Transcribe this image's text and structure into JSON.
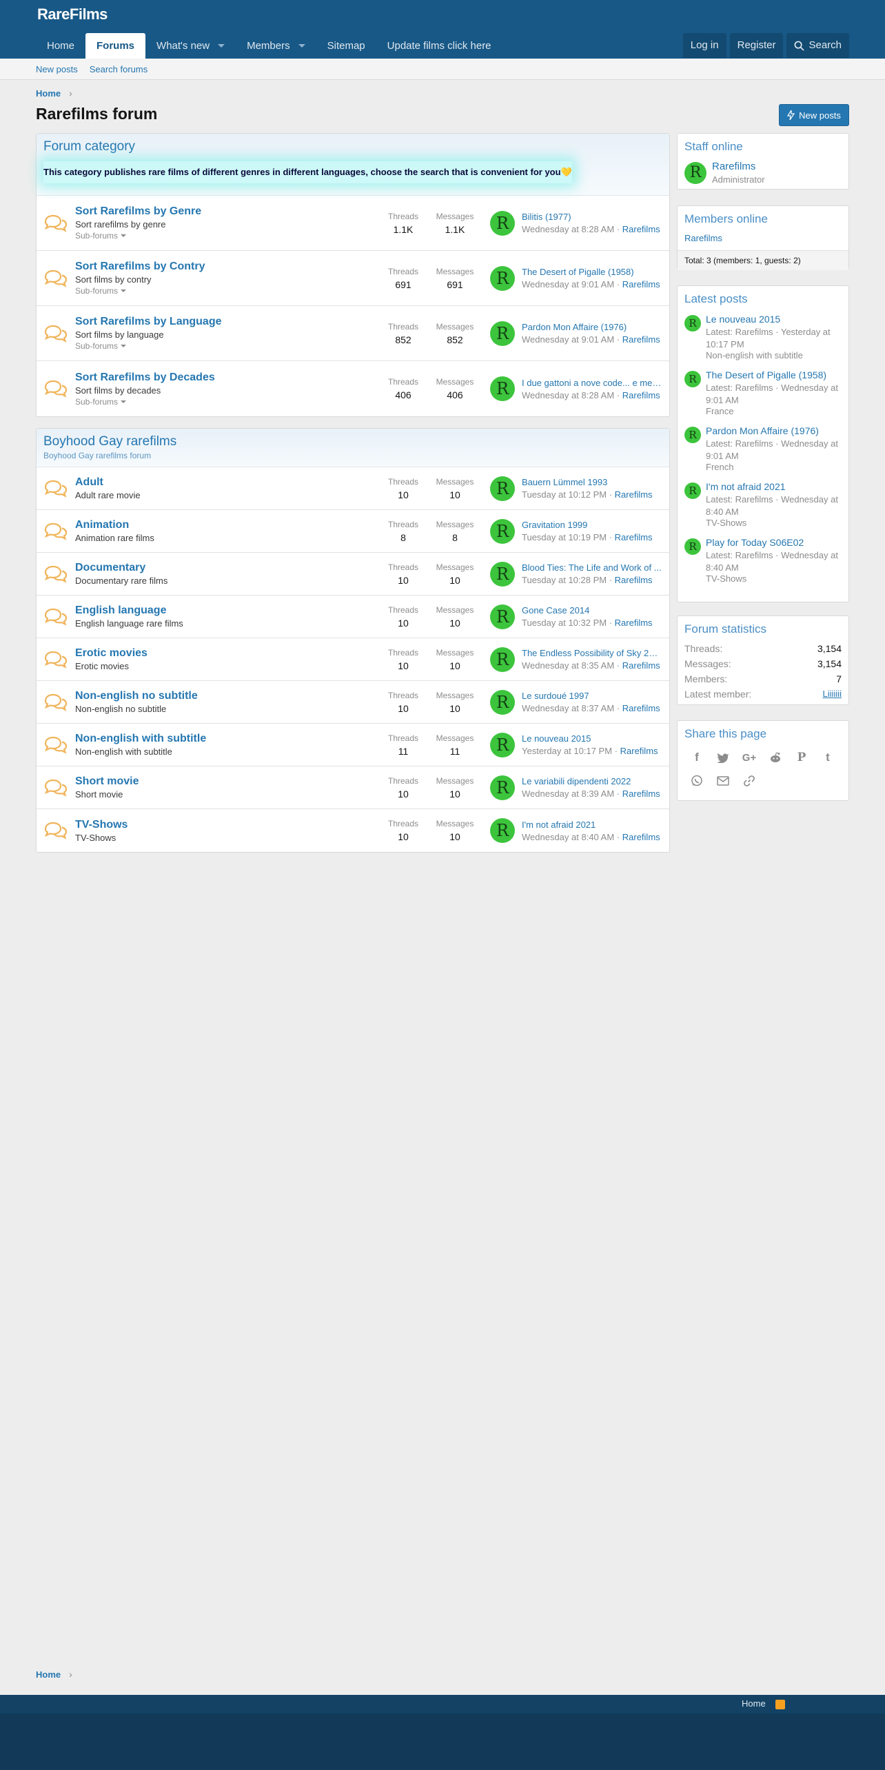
{
  "site": {
    "logo": "RareFilms"
  },
  "nav": {
    "tabs": [
      {
        "label": "Home"
      },
      {
        "label": "Forums"
      },
      {
        "label": "What's new"
      },
      {
        "label": "Members"
      },
      {
        "label": "Sitemap"
      },
      {
        "label": "Update films click here"
      }
    ],
    "login": "Log in",
    "register": "Register",
    "search": "Search"
  },
  "subnav": {
    "new_posts": "New posts",
    "search_forums": "Search forums"
  },
  "breadcrumb": {
    "home": "Home"
  },
  "page": {
    "title": "Rarefilms forum",
    "new_posts_button": "New posts"
  },
  "category_block": {
    "title": "Forum category",
    "banner": "This category publishes rare films of different genres in different languages, choose the search that is convenient for you💛",
    "nodes": [
      {
        "title": "Sort Rarefilms by Genre",
        "desc": "Sort rarefilms by genre",
        "sub": "Sub-forums",
        "threads": "1.1K",
        "messages": "1.1K",
        "last_title": "Bilitis (1977)",
        "last_date": "Wednesday at 8:28 AM",
        "last_user": "Rarefilms",
        "avatar": "R"
      },
      {
        "title": "Sort Rarefilms by Contry",
        "desc": "Sort films by contry",
        "sub": "Sub-forums",
        "threads": "691",
        "messages": "691",
        "last_title": "The Desert of Pigalle (1958)",
        "last_date": "Wednesday at 9:01 AM",
        "last_user": "Rarefilms",
        "avatar": "R"
      },
      {
        "title": "Sort Rarefilms by Language",
        "desc": "Sort films by language",
        "sub": "Sub-forums",
        "threads": "852",
        "messages": "852",
        "last_title": "Pardon Mon Affaire (1976)",
        "last_date": "Wednesday at 9:01 AM",
        "last_user": "Rarefilms",
        "avatar": "R"
      },
      {
        "title": "Sort Rarefilms by Decades",
        "desc": "Sort films by decades",
        "sub": "Sub-forums",
        "threads": "406",
        "messages": "406",
        "last_title": "I due gattoni a nove code... e mez...",
        "last_date": "Wednesday at 8:28 AM",
        "last_user": "Rarefilms",
        "avatar": "R"
      }
    ]
  },
  "gay_block": {
    "title": "Boyhood Gay rarefilms",
    "desc": "Boyhood Gay rarefilms forum",
    "nodes": [
      {
        "title": "Adult",
        "desc": "Adult rare movie",
        "threads": "10",
        "messages": "10",
        "last_title": "Bauern Lümmel 1993",
        "last_date": "Tuesday at 10:12 PM",
        "last_user": "Rarefilms",
        "avatar": "R"
      },
      {
        "title": "Animation",
        "desc": "Animation rare films",
        "threads": "8",
        "messages": "8",
        "last_title": "Gravitation 1999",
        "last_date": "Tuesday at 10:19 PM",
        "last_user": "Rarefilms",
        "avatar": "R"
      },
      {
        "title": "Documentary",
        "desc": "Documentary rare films",
        "threads": "10",
        "messages": "10",
        "last_title": "Blood Ties: The Life and Work of ...",
        "last_date": "Tuesday at 10:28 PM",
        "last_user": "Rarefilms",
        "avatar": "R"
      },
      {
        "title": "English language",
        "desc": "English language rare films",
        "threads": "10",
        "messages": "10",
        "last_title": "Gone Case 2014",
        "last_date": "Tuesday at 10:32 PM",
        "last_user": "Rarefilms",
        "avatar": "R"
      },
      {
        "title": "Erotic movies",
        "desc": "Erotic movies",
        "threads": "10",
        "messages": "10",
        "last_title": "The Endless Possibility of Sky 2012",
        "last_date": "Wednesday at 8:35 AM",
        "last_user": "Rarefilms",
        "avatar": "R"
      },
      {
        "title": "Non-english no subtitle",
        "desc": "Non-english no subtitle",
        "threads": "10",
        "messages": "10",
        "last_title": "Le surdoué 1997",
        "last_date": "Wednesday at 8:37 AM",
        "last_user": "Rarefilms",
        "avatar": "R"
      },
      {
        "title": "Non-english with subtitle",
        "desc": "Non-english with subtitle",
        "threads": "11",
        "messages": "11",
        "last_title": "Le nouveau 2015",
        "last_date": "Yesterday at 10:17 PM",
        "last_user": "Rarefilms",
        "avatar": "R"
      },
      {
        "title": "Short movie",
        "desc": "Short movie",
        "threads": "10",
        "messages": "10",
        "last_title": "Le variabili dipendenti 2022",
        "last_date": "Wednesday at 8:39 AM",
        "last_user": "Rarefilms",
        "avatar": "R"
      },
      {
        "title": "TV-Shows",
        "desc": "TV-Shows",
        "threads": "10",
        "messages": "10",
        "last_title": "I'm not afraid 2021",
        "last_date": "Wednesday at 8:40 AM",
        "last_user": "Rarefilms",
        "avatar": "R"
      }
    ]
  },
  "labels": {
    "threads": "Threads",
    "messages": "Messages"
  },
  "staff_online": {
    "title": "Staff online",
    "name": "Rarefilms",
    "role": "Administrator",
    "avatar": "R"
  },
  "members_online": {
    "title": "Members online",
    "user": "Rarefilms",
    "total": "Total: 3 (members: 1, guests: 2)"
  },
  "latest_posts": {
    "title": "Latest posts",
    "items": [
      {
        "title": "Le nouveau 2015",
        "meta": "Latest: Rarefilms · Yesterday at 10:17 PM",
        "forum": "Non-english with subtitle",
        "avatar": "R"
      },
      {
        "title": "The Desert of Pigalle (1958)",
        "meta": "Latest: Rarefilms · Wednesday at 9:01 AM",
        "forum": "France",
        "avatar": "R"
      },
      {
        "title": "Pardon Mon Affaire (1976)",
        "meta": "Latest: Rarefilms · Wednesday at 9:01 AM",
        "forum": "French",
        "avatar": "R"
      },
      {
        "title": "I'm not afraid 2021",
        "meta": "Latest: Rarefilms · Wednesday at 8:40 AM",
        "forum": "TV-Shows",
        "avatar": "R"
      },
      {
        "title": "Play for Today S06E02",
        "meta": "Latest: Rarefilms · Wednesday at 8:40 AM",
        "forum": "TV-Shows",
        "avatar": "R"
      }
    ]
  },
  "forum_stats": {
    "title": "Forum statistics",
    "threads_label": "Threads:",
    "threads": "3,154",
    "messages_label": "Messages:",
    "messages": "3,154",
    "members_label": "Members:",
    "members": "7",
    "latest_label": "Latest member:",
    "latest": "Liiiiiii"
  },
  "share": {
    "title": "Share this page",
    "icons": [
      "facebook-icon",
      "twitter-icon",
      "google-plus-icon",
      "reddit-icon",
      "pinterest-icon",
      "tumblr-icon",
      "whatsapp-icon",
      "email-icon",
      "link-icon"
    ]
  },
  "footer": {
    "home": "Home"
  },
  "colors": {
    "header": "#185886",
    "link": "#2577b1",
    "avatar": "#3cc43c",
    "footer": "#123a58",
    "forum_icon": "#f0b45a"
  }
}
